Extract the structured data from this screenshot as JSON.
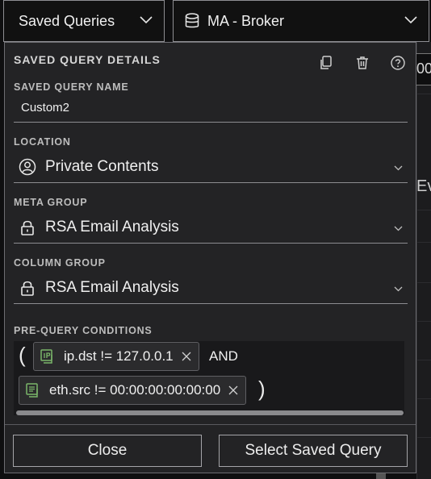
{
  "topbar": {
    "saved_queries_label": "Saved Queries",
    "service_label": "MA - Broker"
  },
  "background": {
    "input_fragment": "00",
    "events_fragment": "Ev"
  },
  "popover": {
    "title": "SAVED QUERY DETAILS",
    "icons": [
      "copy-icon",
      "trash-icon",
      "help-icon"
    ],
    "name_label": "SAVED QUERY NAME",
    "name_value": "Custom2",
    "location_label": "LOCATION",
    "location_value": "Private Contents",
    "meta_group_label": "META GROUP",
    "meta_group_value": "RSA Email Analysis",
    "column_group_label": "COLUMN GROUP",
    "column_group_value": "RSA Email Analysis",
    "conditions_label": "PRE-QUERY CONDITIONS",
    "open_paren": "(",
    "close_paren": ")",
    "conditions": [
      {
        "text": "ip.dst != 127.0.0.1",
        "icon": "ip-meta-icon"
      },
      {
        "text": "eth.src != 00:00:00:00:00:00",
        "icon": "mac-meta-icon"
      }
    ],
    "operator": "AND",
    "close_button": "Close",
    "select_button": "Select Saved Query"
  },
  "colors": {
    "popover_bg": "#232325",
    "condition_icon": "#7bb66a",
    "border": "#8c8c90"
  }
}
